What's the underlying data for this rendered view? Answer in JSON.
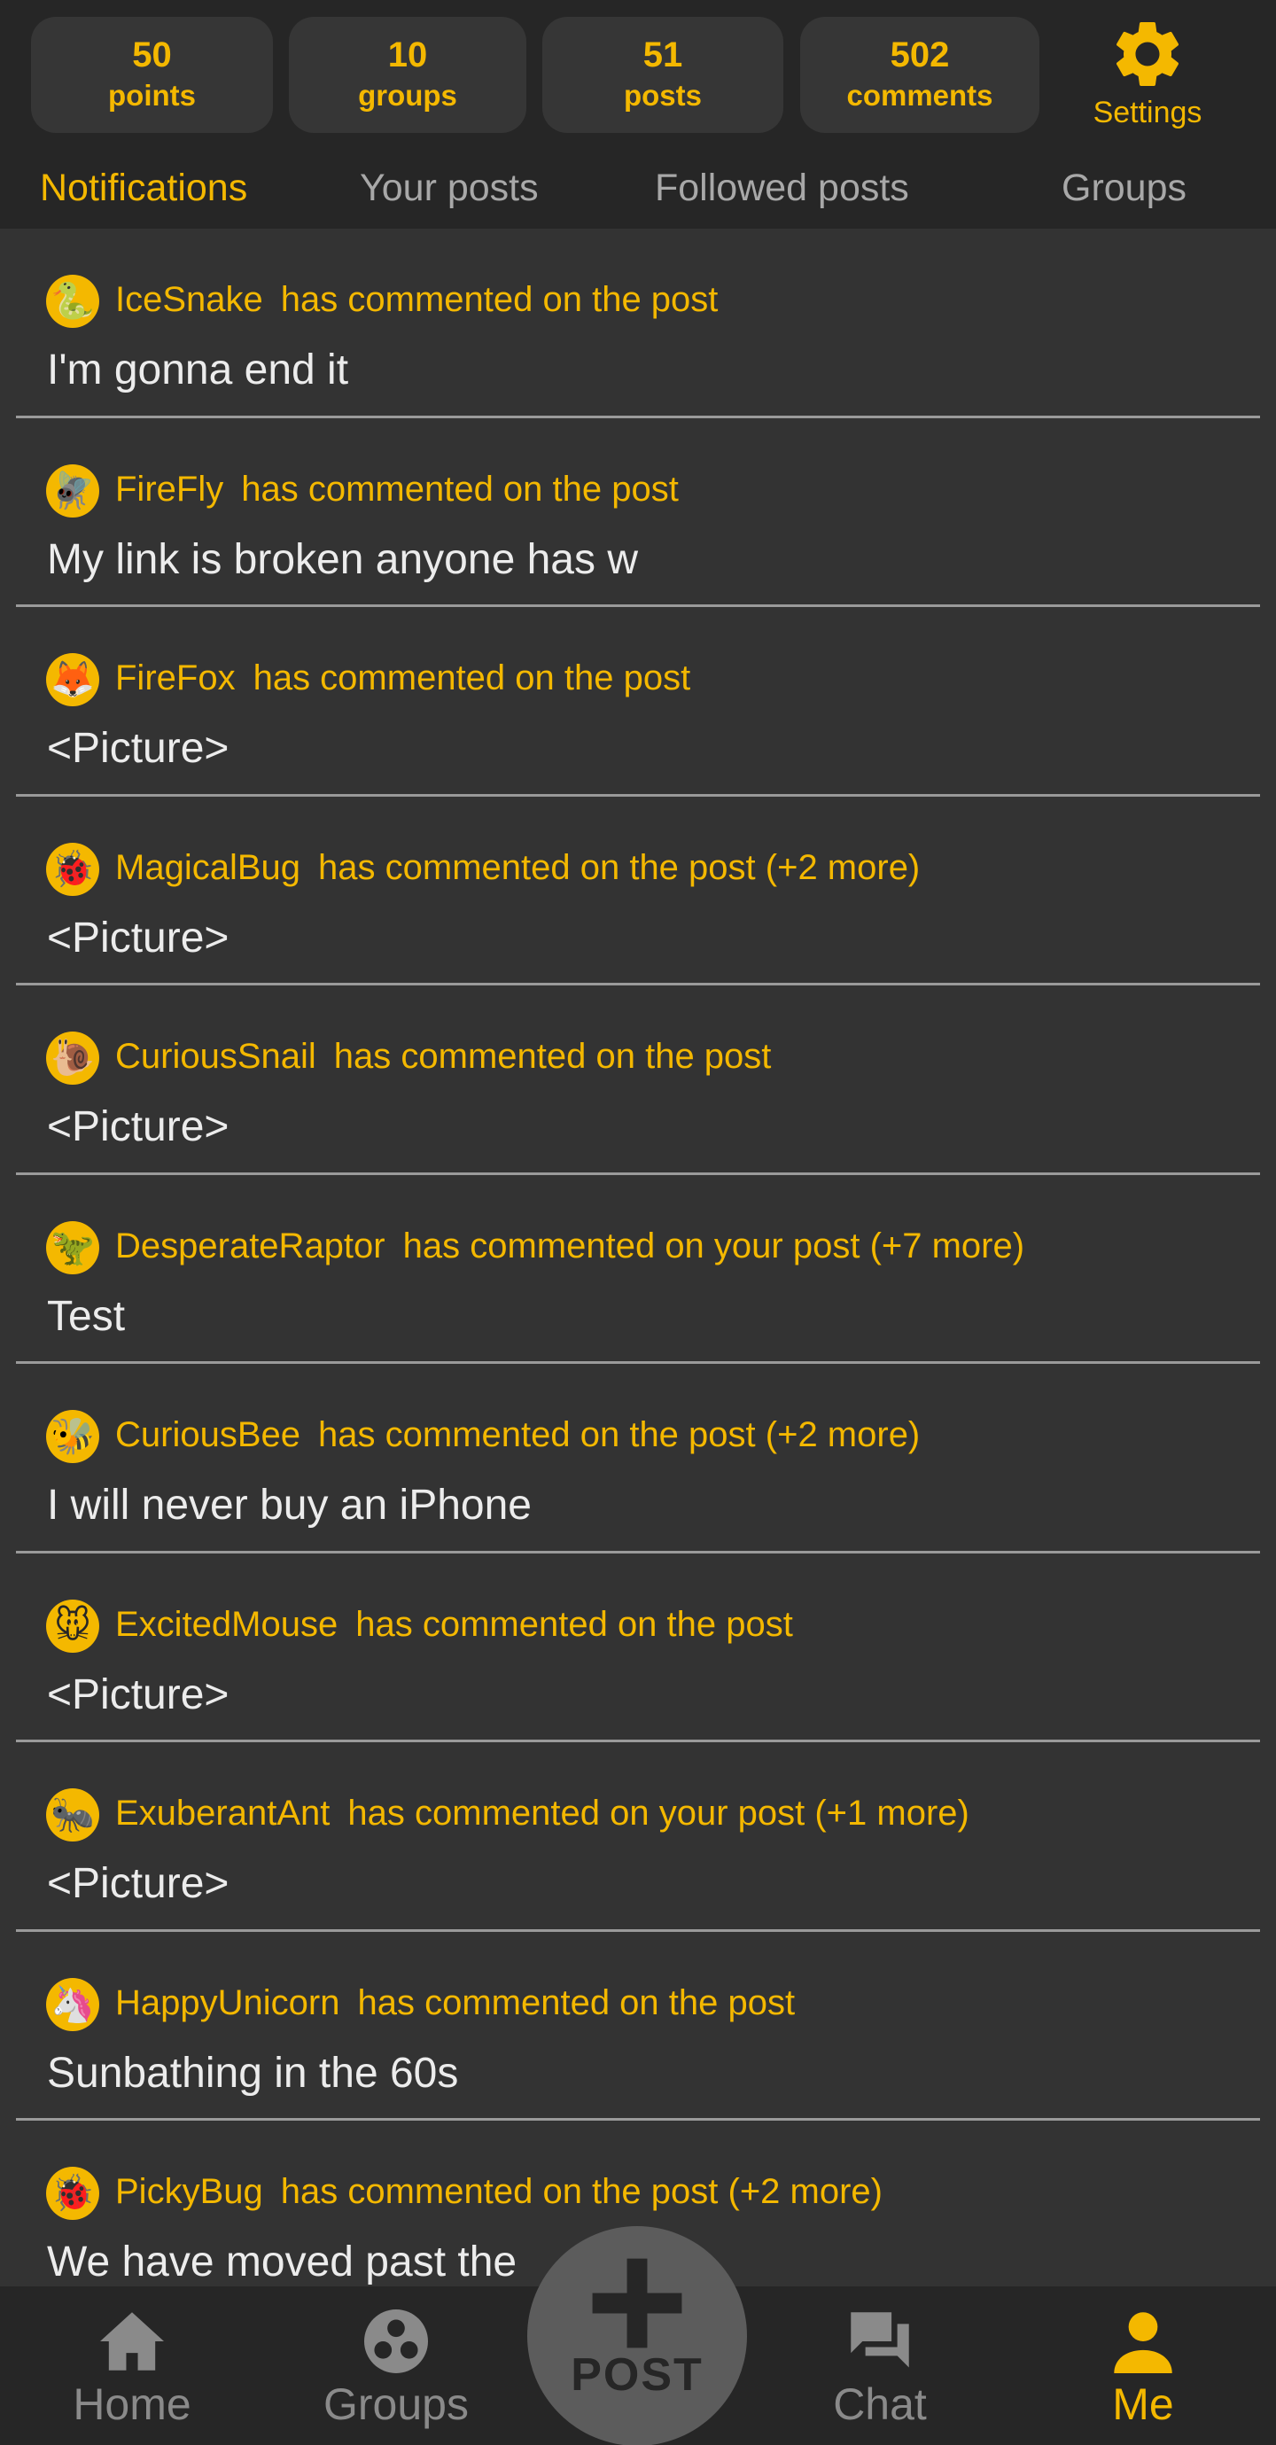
{
  "stats": [
    {
      "value": "50",
      "label": "points"
    },
    {
      "value": "10",
      "label": "groups"
    },
    {
      "value": "51",
      "label": "posts"
    },
    {
      "value": "502",
      "label": "comments"
    }
  ],
  "settings_label": "Settings",
  "tabs": [
    {
      "label": "Notifications",
      "active": true
    },
    {
      "label": "Your posts",
      "active": false
    },
    {
      "label": "Followed posts",
      "active": false
    },
    {
      "label": "Groups",
      "active": false
    }
  ],
  "notifications": [
    {
      "user": "IceSnake",
      "action": "has commented on the post",
      "text": "I'm gonna end it",
      "avatar": "snake-icon",
      "glyph": "🐍"
    },
    {
      "user": "FireFly",
      "action": "has commented on the post",
      "text": "My link is broken anyone has w",
      "avatar": "firefly-icon",
      "glyph": "🪰"
    },
    {
      "user": "FireFox",
      "action": "has commented on the post",
      "text": "<Picture>",
      "avatar": "fox-icon",
      "glyph": "🦊"
    },
    {
      "user": "MagicalBug",
      "action": "has commented on the post (+2 more)",
      "text": "<Picture>",
      "avatar": "ladybug-icon",
      "glyph": "🐞"
    },
    {
      "user": "CuriousSnail",
      "action": "has commented on the post",
      "text": "<Picture>",
      "avatar": "snail-icon",
      "glyph": "🐌"
    },
    {
      "user": "DesperateRaptor",
      "action": "has commented on your post (+7 more)",
      "text": "Test",
      "avatar": "raptor-icon",
      "glyph": "🦖"
    },
    {
      "user": "CuriousBee",
      "action": "has commented on the post (+2 more)",
      "text": "I will never buy an iPhone",
      "avatar": "bee-icon",
      "glyph": "🐝"
    },
    {
      "user": "ExcitedMouse",
      "action": "has commented on the post",
      "text": "<Picture>",
      "avatar": "mouse-icon",
      "glyph": "🐭"
    },
    {
      "user": "ExuberantAnt",
      "action": "has commented on your post (+1 more)",
      "text": "<Picture>",
      "avatar": "ant-icon",
      "glyph": "🐜"
    },
    {
      "user": "HappyUnicorn",
      "action": "has commented on the post",
      "text": "Sunbathing in the 60s",
      "avatar": "unicorn-icon",
      "glyph": "🦄"
    },
    {
      "user": "PickyBug",
      "action": "has commented on the post (+2 more)",
      "text": "We have moved past the",
      "avatar": "ladybug-icon",
      "glyph": "🐞"
    }
  ],
  "nav": {
    "home": "Home",
    "groups": "Groups",
    "post": "POST",
    "chat": "Chat",
    "me": "Me"
  },
  "colors": {
    "accent": "#f4b800",
    "background": "#333333",
    "header": "#262626"
  }
}
